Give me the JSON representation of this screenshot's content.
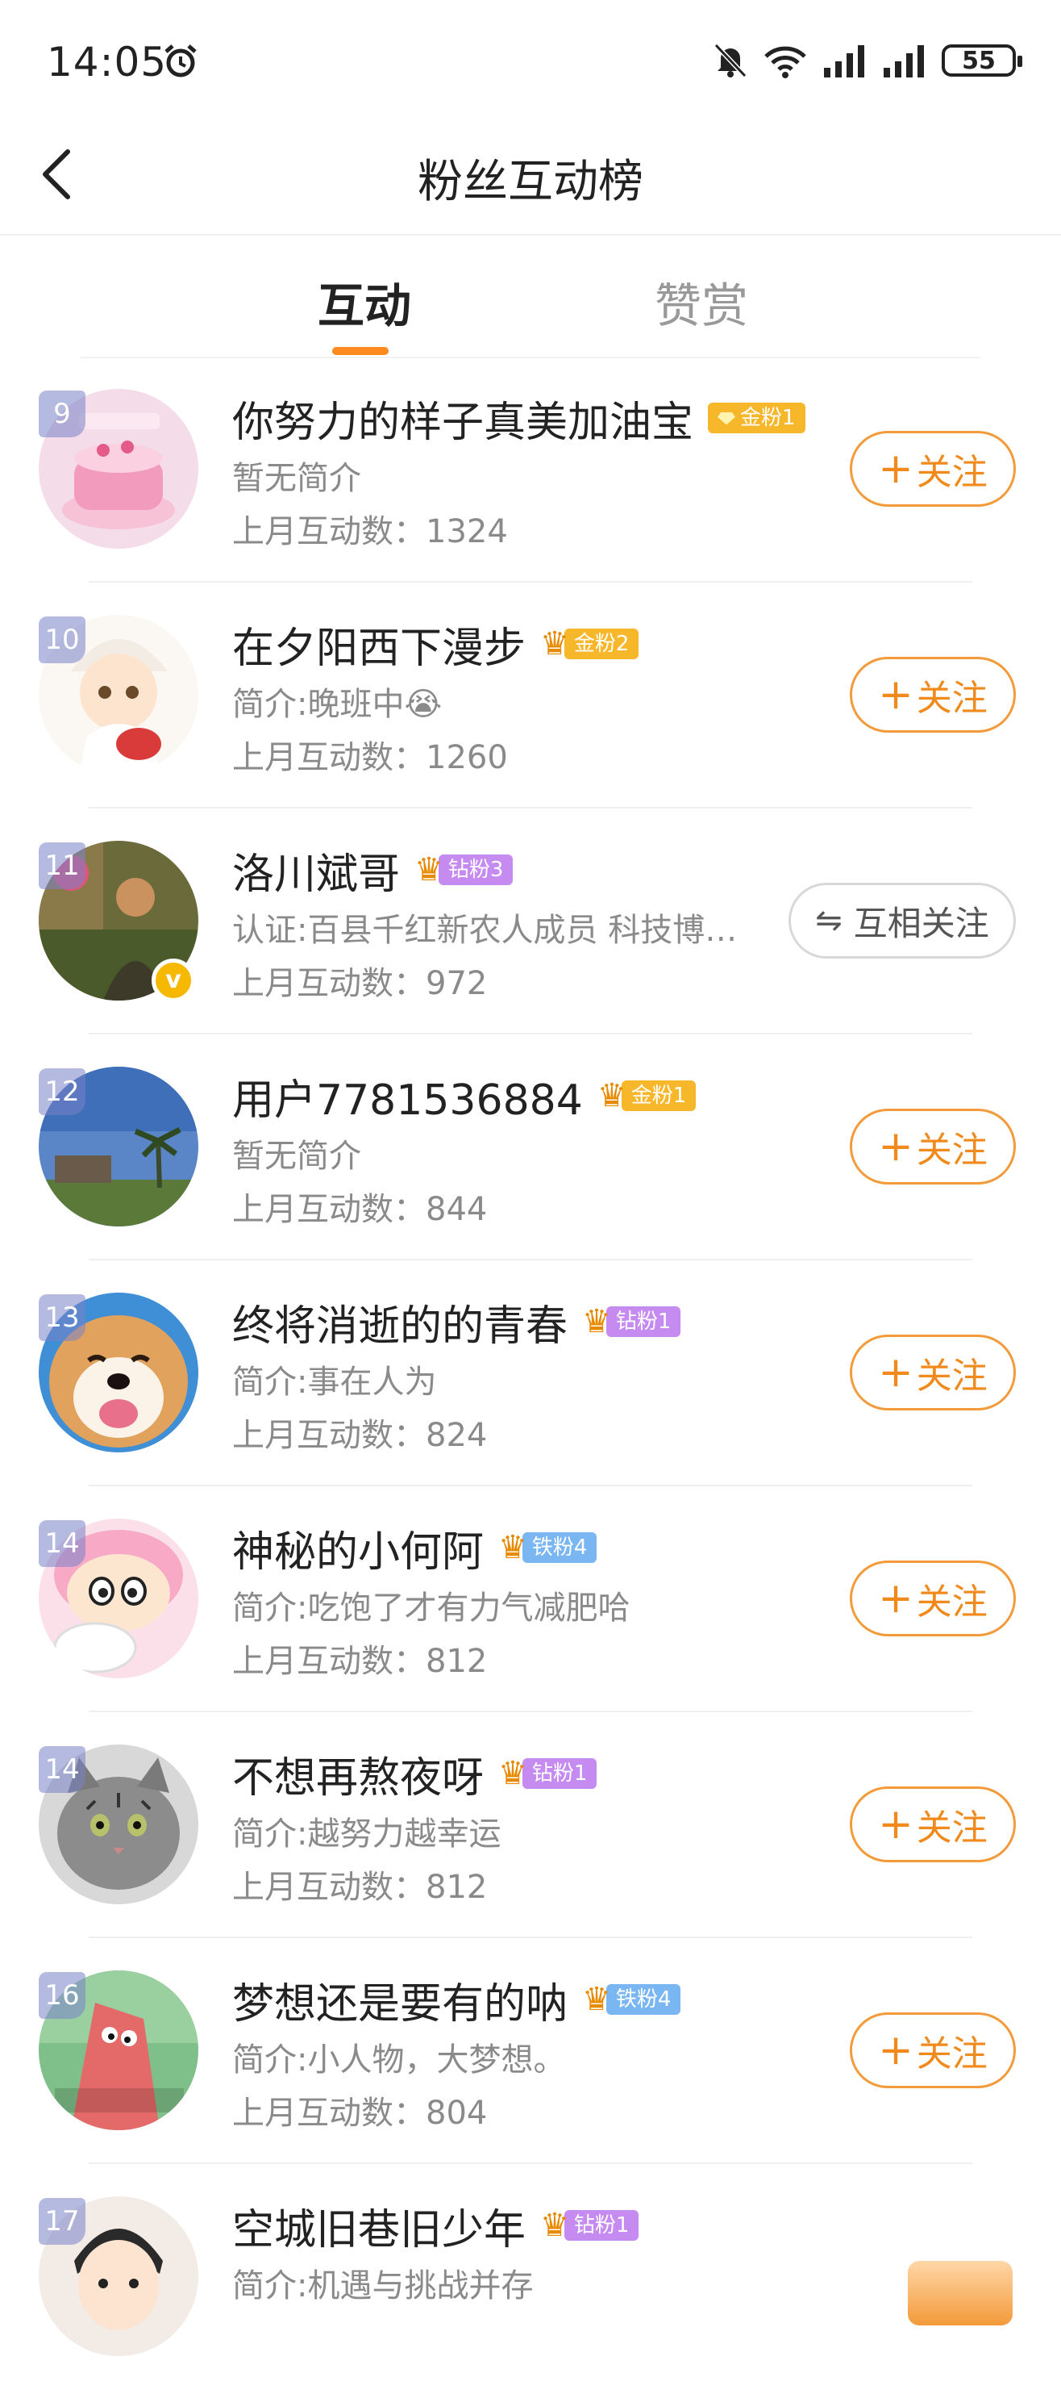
{
  "status_bar": {
    "time": "14:05",
    "battery": "55",
    "icons": [
      "alarm-icon",
      "mute-icon",
      "wifi-icon",
      "signal-icon",
      "signal-icon",
      "battery-icon"
    ]
  },
  "header": {
    "title": "粉丝互动榜",
    "back_icon": "back-arrow-icon"
  },
  "tabs": [
    {
      "label": "互动",
      "active": true
    },
    {
      "label": "赞赏",
      "active": false
    }
  ],
  "stat_label": "上月互动数：",
  "button_follow": "关注",
  "button_follow_plus": "+",
  "button_mutual": "互相关注",
  "colors": {
    "accent": "#ff8a1f",
    "gold_badge": "#f7b72a",
    "diamond_badge": "#c58bf0",
    "iron_badge": "#7ab6f2",
    "verified": "#f6b800"
  },
  "fans": [
    {
      "rank": "9",
      "name": "你努力的样子真美加油宝",
      "badge": "金粉1",
      "badge_type": "gold",
      "crown": false,
      "bio": "暂无简介",
      "count": "1324",
      "action": "follow"
    },
    {
      "rank": "10",
      "name": "在夕阳西下漫步",
      "badge": "金粉2",
      "badge_type": "gold",
      "crown": true,
      "bio": "简介:晚班中😭",
      "count": "1260",
      "action": "follow"
    },
    {
      "rank": "11",
      "name": "洛川斌哥",
      "badge": "钻粉3",
      "badge_type": "diamond",
      "crown": true,
      "bio": "认证:百县千红新农人成员 科技博…",
      "count": "972",
      "action": "mutual",
      "verified": true
    },
    {
      "rank": "12",
      "name": "用户7781536884",
      "badge": "金粉1",
      "badge_type": "gold",
      "crown": true,
      "bio": "暂无简介",
      "count": "844",
      "action": "follow"
    },
    {
      "rank": "13",
      "name": "终将消逝的的青春",
      "badge": "钻粉1",
      "badge_type": "diamond",
      "crown": true,
      "bio": "简介:事在人为",
      "count": "824",
      "action": "follow"
    },
    {
      "rank": "14",
      "name": "神秘的小何阿",
      "badge": "铁粉4",
      "badge_type": "iron",
      "crown": true,
      "bio": "简介:吃饱了才有力气减肥哈",
      "count": "812",
      "action": "follow"
    },
    {
      "rank": "14",
      "name": "不想再熬夜呀",
      "badge": "钻粉1",
      "badge_type": "diamond",
      "crown": true,
      "bio": "简介:越努力越幸运",
      "count": "812",
      "action": "follow"
    },
    {
      "rank": "16",
      "name": "梦想还是要有的呐",
      "badge": "铁粉4",
      "badge_type": "iron",
      "crown": true,
      "bio": "简介:小人物，大梦想。",
      "count": "804",
      "action": "follow"
    },
    {
      "rank": "17",
      "name": "空城旧巷旧少年",
      "badge": "钻粉1",
      "badge_type": "diamond",
      "crown": true,
      "bio": "简介:机遇与挑战并存",
      "count": "",
      "action": "follow-partial"
    }
  ]
}
